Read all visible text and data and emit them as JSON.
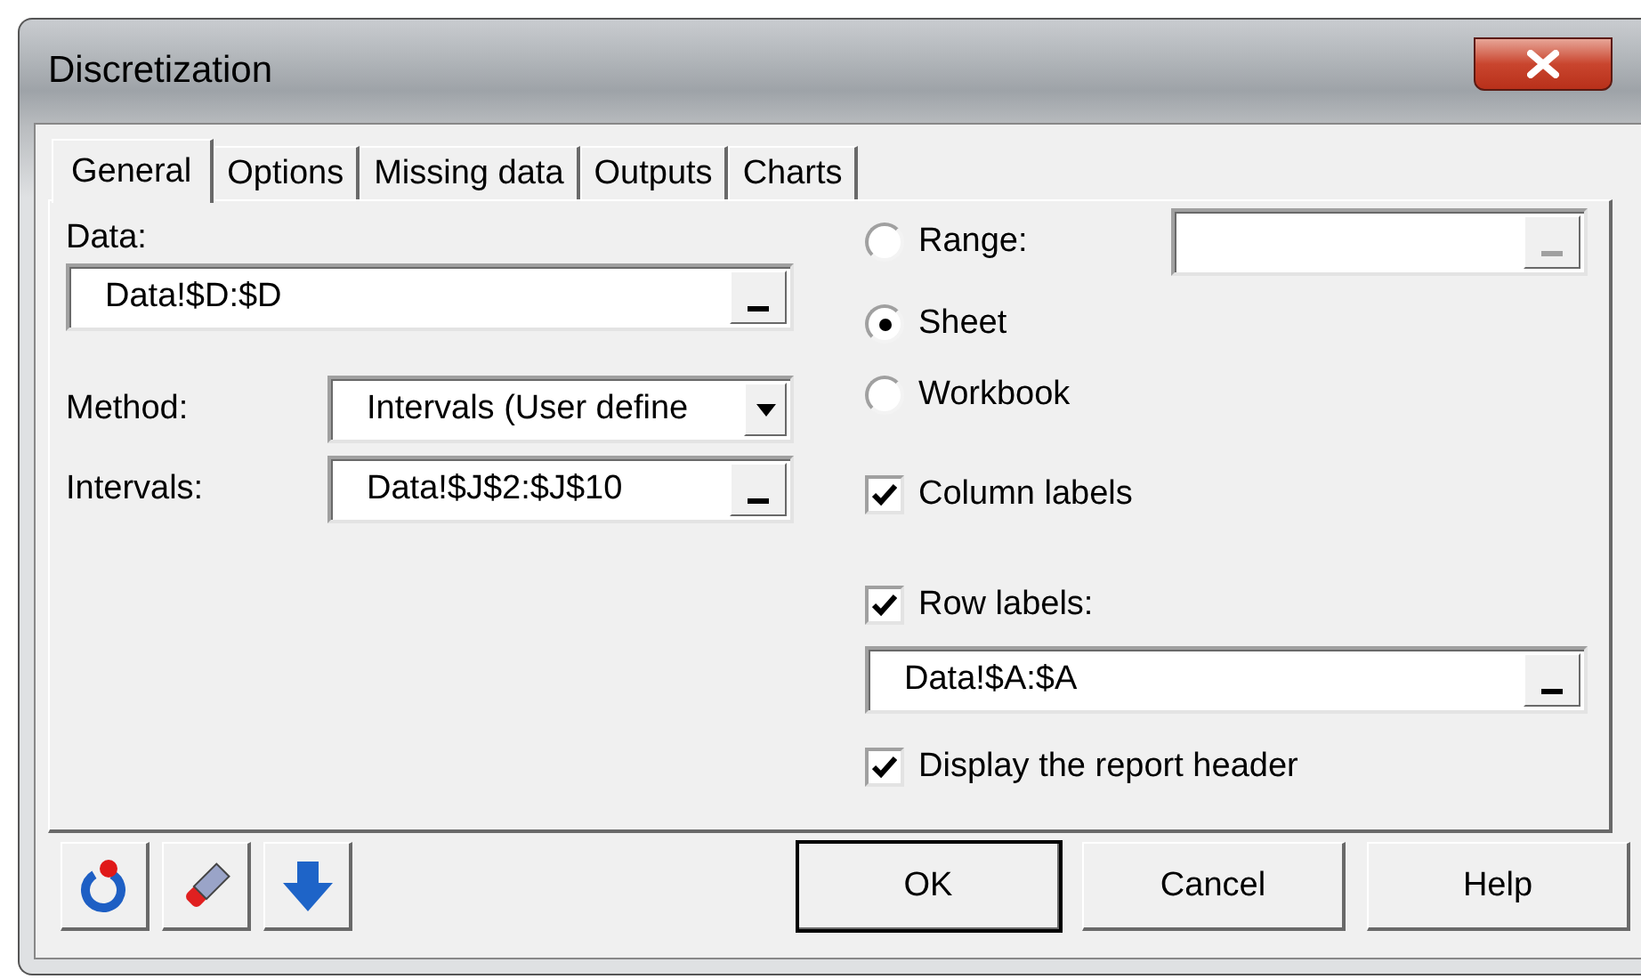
{
  "window": {
    "title": "Discretization"
  },
  "tabs": [
    {
      "label": "General",
      "selected": true
    },
    {
      "label": "Options",
      "selected": false
    },
    {
      "label": "Missing data",
      "selected": false
    },
    {
      "label": "Outputs",
      "selected": false
    },
    {
      "label": "Charts",
      "selected": false
    }
  ],
  "general": {
    "data": {
      "label": "Data:",
      "value": "Data!$D:$D"
    },
    "method": {
      "label": "Method:",
      "value": "Intervals (User define"
    },
    "intervals": {
      "label": "Intervals:",
      "value": "Data!$J$2:$J$10"
    },
    "scope": [
      {
        "label": "Range:",
        "selected": false
      },
      {
        "label": "Sheet",
        "selected": true
      },
      {
        "label": "Workbook",
        "selected": false
      }
    ],
    "range_field": {
      "disabled": true
    },
    "column_labels": {
      "label": "Column labels",
      "checked": true
    },
    "row_labels": {
      "label": "Row labels:",
      "checked": true,
      "value": "Data!$A:$A"
    },
    "report_header": {
      "label": "Display the report header",
      "checked": true
    }
  },
  "buttons": [
    {
      "label": "OK",
      "default": true
    },
    {
      "label": "Cancel",
      "default": false
    },
    {
      "label": "Help",
      "default": false
    }
  ]
}
